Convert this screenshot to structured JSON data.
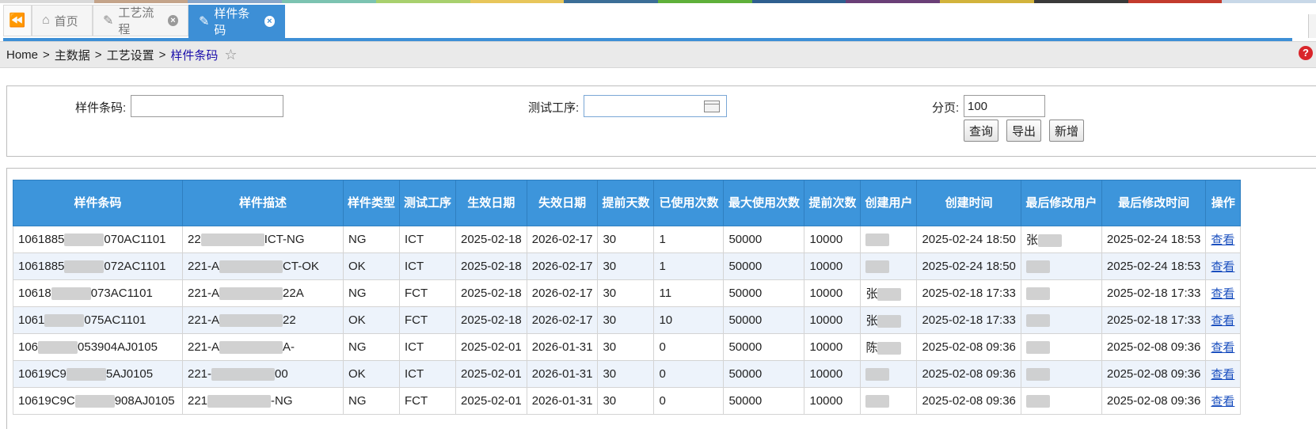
{
  "strip_colors": [
    "#d9d9d9",
    "#c4a48a",
    "#8aa6c9",
    "#7cc3b1",
    "#a8d06e",
    "#e8c65b",
    "#3c6e97",
    "#5fb03a",
    "#2f5f8f",
    "#6a3f77",
    "#d2b33c",
    "#3a3a3a",
    "#c33b2d",
    "#c8d8e8"
  ],
  "tabs": {
    "home": "首页",
    "process": "工艺流程",
    "sample": "样件条码"
  },
  "breadcrumb": {
    "home": "Home",
    "level1": "主数据",
    "level2": "工艺设置",
    "current": "样件条码",
    "separator": ">"
  },
  "search": {
    "barcode_label": "样件条码:",
    "barcode_value": "",
    "process_label": "测试工序:",
    "page_label": "分页:",
    "page_value": "100",
    "query_btn": "查询",
    "export_btn": "导出",
    "add_btn": "新增"
  },
  "table": {
    "headers": [
      "样件条码",
      "样件描述",
      "样件类型",
      "测试工序",
      "生效日期",
      "失效日期",
      "提前天数",
      "已使用次数",
      "最大使用次数",
      "提前次数",
      "创建用户",
      "创建时间",
      "最后修改用户",
      "最后修改时间",
      "操作"
    ],
    "view_label": "查看",
    "rows": [
      {
        "barcode_a": "1061885",
        "barcode_b": "070AC1101",
        "desc_a": "22",
        "desc_b": "ICT-NG",
        "type": "NG",
        "process": "ICT",
        "start": "2025-02-18",
        "end": "2026-02-17",
        "days": "30",
        "used": "1",
        "max": "50000",
        "ahead": "10000",
        "creator": "",
        "created": "2025-02-24 18:50",
        "modifier": "张",
        "modified": "2025-02-24 18:53"
      },
      {
        "barcode_a": "1061885",
        "barcode_b": "072AC1101",
        "desc_a": "221-A",
        "desc_b": "CT-OK",
        "type": "OK",
        "process": "ICT",
        "start": "2025-02-18",
        "end": "2026-02-17",
        "days": "30",
        "used": "1",
        "max": "50000",
        "ahead": "10000",
        "creator": "",
        "created": "2025-02-24 18:50",
        "modifier": "",
        "modified": "2025-02-24 18:53"
      },
      {
        "barcode_a": "10618",
        "barcode_b": "073AC1101",
        "desc_a": "221-A",
        "desc_b": "22A",
        "type": "NG",
        "process": "FCT",
        "start": "2025-02-18",
        "end": "2026-02-17",
        "days": "30",
        "used": "11",
        "max": "50000",
        "ahead": "10000",
        "creator": "张",
        "created": "2025-02-18 17:33",
        "modifier": "",
        "modified": "2025-02-18 17:33"
      },
      {
        "barcode_a": "1061",
        "barcode_b": "075AC1101",
        "desc_a": "221-A",
        "desc_b": "22",
        "type": "OK",
        "process": "FCT",
        "start": "2025-02-18",
        "end": "2026-02-17",
        "days": "30",
        "used": "10",
        "max": "50000",
        "ahead": "10000",
        "creator": "张",
        "created": "2025-02-18 17:33",
        "modifier": "",
        "modified": "2025-02-18 17:33"
      },
      {
        "barcode_a": "106",
        "barcode_b": "053904AJ0105",
        "desc_a": "221-A",
        "desc_b": "A-",
        "type": "NG",
        "process": "ICT",
        "start": "2025-02-01",
        "end": "2026-01-31",
        "days": "30",
        "used": "0",
        "max": "50000",
        "ahead": "10000",
        "creator": "陈",
        "created": "2025-02-08 09:36",
        "modifier": "",
        "modified": "2025-02-08 09:36"
      },
      {
        "barcode_a": "10619C9",
        "barcode_b": "5AJ0105",
        "desc_a": "221-",
        "desc_b": "00",
        "type": "OK",
        "process": "ICT",
        "start": "2025-02-01",
        "end": "2026-01-31",
        "days": "30",
        "used": "0",
        "max": "50000",
        "ahead": "10000",
        "creator": "",
        "created": "2025-02-08 09:36",
        "modifier": "",
        "modified": "2025-02-08 09:36"
      },
      {
        "barcode_a": "10619C9C",
        "barcode_b": "908AJ0105",
        "desc_a": "221",
        "desc_b": "-NG",
        "type": "NG",
        "process": "FCT",
        "start": "2025-02-01",
        "end": "2026-01-31",
        "days": "30",
        "used": "0",
        "max": "50000",
        "ahead": "10000",
        "creator": "",
        "created": "2025-02-08 09:36",
        "modifier": "",
        "modified": "2025-02-08 09:36"
      }
    ]
  }
}
